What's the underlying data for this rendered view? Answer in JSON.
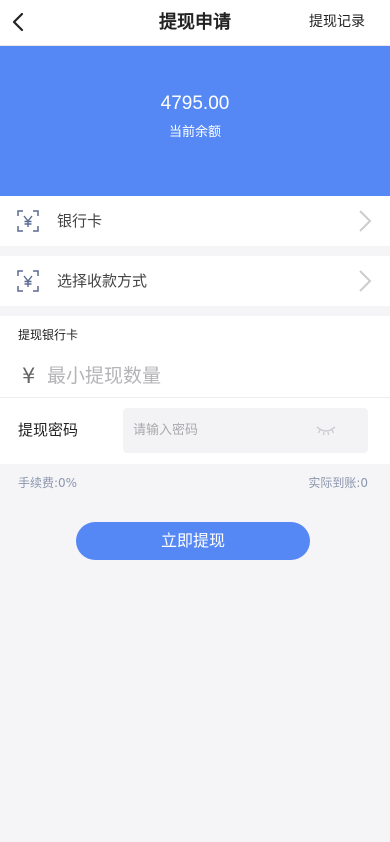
{
  "header": {
    "back_icon": "chevron-left-icon",
    "title": "提现申请",
    "right_link": "提现记录"
  },
  "balance": {
    "amount": "4795.00",
    "label": "当前余额",
    "background_color": "#5588f5"
  },
  "options": [
    {
      "icon": "yen-scan-icon",
      "label": "银行卡",
      "arrow_icon": "chevron-right-icon"
    },
    {
      "icon": "yen-scan-icon",
      "label": "选择收款方式",
      "arrow_icon": "chevron-right-icon"
    }
  ],
  "form": {
    "section_label": "提现银行卡",
    "currency_symbol": "¥",
    "amount_placeholder": "最小提现数量",
    "password_label": "提现密码",
    "password_placeholder": "请输入密码",
    "password_toggle_icon": "eye-closed-icon"
  },
  "fees": {
    "fee_text": "手续费:0%",
    "actual_text": "实际到账:0"
  },
  "submit": {
    "label": "立即提现",
    "color": "#5588f5"
  }
}
